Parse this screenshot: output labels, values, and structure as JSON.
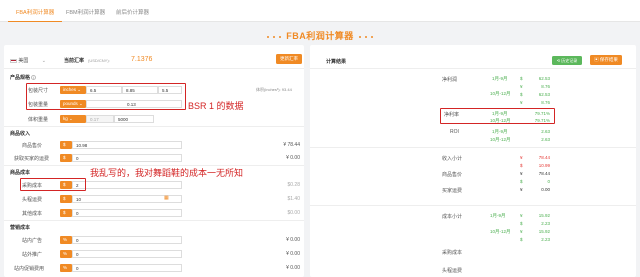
{
  "tabs": [
    "FBA利润计算器",
    "FBM利润计算器",
    "前后价计算器"
  ],
  "page_title": "FBA利润计算器",
  "left": {
    "country": "美国",
    "rate_label": "当前汇率",
    "rate_unit": "(USD/CNY):",
    "rate_value": "7.1376",
    "update_btn": "更新汇率",
    "product_section": "产品规格",
    "size_label": "包装尺寸",
    "size_unit": "inches",
    "dims": [
      "6.5",
      "8.85",
      "5.5"
    ],
    "weight_label": "包装重量",
    "weight_unit": "pounds",
    "weight_value": "0.13",
    "vol_label": "体积重量",
    "vol_unit": "kg",
    "vol_value": "0.17",
    "vol_divisor": "5000",
    "dim_note": "体积(inches³): 93.44",
    "income_section": "商品收入",
    "price_label": "商品售价",
    "price_value": "10.98",
    "price_total": "¥ 78.44",
    "ship_label": "获取买家的运费",
    "ship_value": "0",
    "ship_total": "¥ 0.00",
    "cost_section": "商品成本",
    "purchase_label": "采购成本",
    "purchase_value": "2",
    "purchase_total": "$0.28",
    "freight_label": "头程运费",
    "freight_value": "10",
    "freight_total": "$1.40",
    "other_label": "其他成本",
    "other_value": "0",
    "other_total": "$0.00",
    "mkt_section": "营销成本",
    "ads_label": "站内广告",
    "ads_value": "0",
    "promo_label": "站外推广",
    "promo_value": "0",
    "coupon_label": "站内促销费用",
    "coupon_value": "0",
    "mkt_totals": [
      "¥ 0.00",
      "¥ 0.00",
      "¥ 0.00"
    ],
    "currency_sign": "$",
    "pct_sign": "%"
  },
  "right": {
    "header": "计算结果",
    "save_btn": "历史记录",
    "export_btn": "保存结果",
    "net_profit": "净利润",
    "margin": "净利率",
    "roi": "ROI",
    "jan_sep": "1月-9月",
    "oct_dec": "10月-12月",
    "np_rows": [
      [
        "$",
        "62.53"
      ],
      [
        "¥",
        "8.76"
      ],
      [
        "$",
        "62.53"
      ],
      [
        "¥",
        "8.76"
      ]
    ],
    "margin_vals": [
      "79.71%",
      "79.71%"
    ],
    "roi_vals": [
      "2.63",
      "2.63"
    ],
    "income_total": "收入小计",
    "price": "商品售价",
    "buyer_ship": "买家运费",
    "cost_total": "成本小计",
    "purchase": "采购成本",
    "freight": "头程运费",
    "income_vals": [
      [
        "¥",
        "78.44"
      ],
      [
        "$",
        "10.99"
      ],
      [
        "¥",
        "78.44"
      ],
      [
        "$",
        "0"
      ],
      [
        "¥",
        "0.00"
      ]
    ],
    "cost_vals": [
      [
        "¥",
        "15.92"
      ],
      [
        "$",
        "2.23"
      ],
      [
        "¥",
        "15.92"
      ],
      [
        "$",
        "2.23"
      ]
    ],
    "cost_note": "10月-12月"
  },
  "annotations": {
    "bsr": "BSR 1 的数据",
    "guess": "我乱写的，我对舞蹈鞋的成本一无所知"
  }
}
